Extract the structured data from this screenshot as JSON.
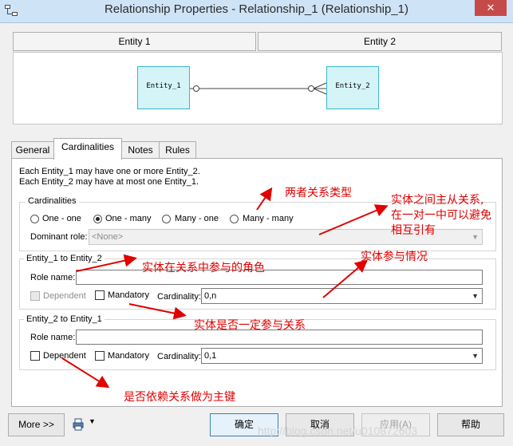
{
  "window": {
    "title": "Relationship Properties - Relationship_1 (Relationship_1)",
    "close_glyph": "✕"
  },
  "header": {
    "entity1": "Entity 1",
    "entity2": "Entity 2"
  },
  "diagram": {
    "entity1_name": "Entity_1",
    "entity2_name": "Entity_2"
  },
  "tabs": [
    "General",
    "Cardinalities",
    "Notes",
    "Rules"
  ],
  "cardinalities_tab": {
    "description_line1": "Each Entity_1 may have one or more Entity_2.",
    "description_line2": "Each Entity_2 may have at most one Entity_1.",
    "group_label": "Cardinalities",
    "options": [
      "One - one",
      "One - many",
      "Many - one",
      "Many - many"
    ],
    "selected_option": "One - many",
    "dominant_role_label": "Dominant role:",
    "dominant_role_value": "<None>",
    "role1": {
      "group_label": "Entity_1 to Entity_2",
      "role_name_label": "Role name:",
      "role_name_value": "",
      "dependent_label": "Dependent",
      "mandatory_label": "Mandatory",
      "cardinality_label": "Cardinality:",
      "cardinality_value": "0,n"
    },
    "role2": {
      "group_label": "Entity_2 to Entity_1",
      "role_name_label": "Role name:",
      "role_name_value": "",
      "dependent_label": "Dependent",
      "mandatory_label": "Mandatory",
      "cardinality_label": "Cardinality:",
      "cardinality_value": "0,1"
    }
  },
  "annotations": {
    "relation_type": "两者关系类型",
    "master_slave_1": "实体之间主从关系,",
    "master_slave_2": "在一对一中可以避免",
    "master_slave_3": "相互引有",
    "role_in_relation": "实体在关系中参与的角色",
    "participation": "实体参与情况",
    "mandatory_participation": "实体是否一定参与关系",
    "dependent_pk": "是否依赖关系做为主键"
  },
  "footer": {
    "more_label": "More >>",
    "ok_label": "确定",
    "cancel_label": "取消",
    "apply_label": "应用(A)",
    "help_label": "帮助"
  },
  "watermark": "http://blog.csdn.net/u010872603",
  "colors": {
    "entity_fill": "#d4f4f8",
    "entity_border": "#3ab7cc",
    "annotation": "#e00000",
    "arrow": "#e00000"
  }
}
